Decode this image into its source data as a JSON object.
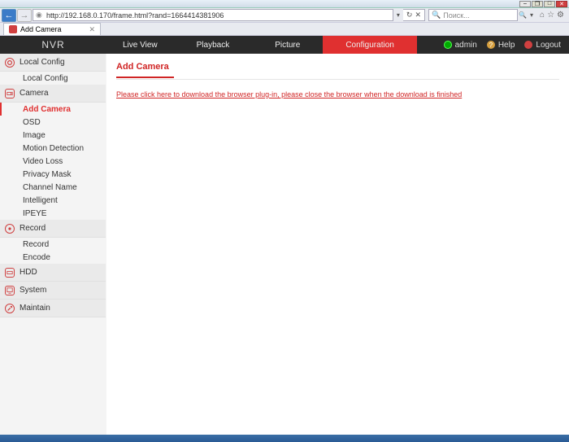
{
  "browser": {
    "url": "http://192.168.0.170/frame.html?rand=1664414381906",
    "search_placeholder": "Поиск...",
    "tab_title": "Add Camera"
  },
  "header": {
    "brand": "NVR",
    "nav": {
      "live": "Live View",
      "playback": "Playback",
      "picture": "Picture",
      "config": "Configuration"
    },
    "user": "admin",
    "help": "Help",
    "logout": "Logout"
  },
  "sidebar": {
    "local_config": {
      "label": "Local Config",
      "items": {
        "local": "Local Config"
      }
    },
    "camera": {
      "label": "Camera",
      "items": {
        "add": "Add Camera",
        "osd": "OSD",
        "image": "Image",
        "motion": "Motion Detection",
        "videoloss": "Video Loss",
        "privacy": "Privacy Mask",
        "channel": "Channel Name",
        "intelligent": "Intelligent",
        "ipeye": "IPEYE"
      }
    },
    "record": {
      "label": "Record",
      "items": {
        "record": "Record",
        "encode": "Encode"
      }
    },
    "hdd": {
      "label": "HDD"
    },
    "system": {
      "label": "System"
    },
    "maintain": {
      "label": "Maintain"
    }
  },
  "content": {
    "title": "Add Camera",
    "plugin_message": "Please click here to download the browser plug-in, please close the browser when the download is finished"
  }
}
